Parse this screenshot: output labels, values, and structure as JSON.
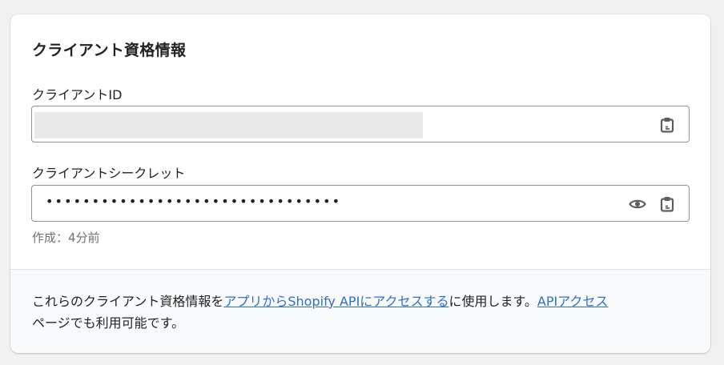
{
  "card": {
    "title": "クライアント資格情報"
  },
  "client_id": {
    "label": "クライアントID",
    "copy_icon": "clipboard-icon"
  },
  "client_secret": {
    "label": "クライアントシークレット",
    "masked_value": "••••••••••••••••••••••••••••••••",
    "reveal_icon": "eye-icon",
    "copy_icon": "clipboard-icon",
    "created": "作成：4分前"
  },
  "footer": {
    "text_1": "これらのクライアント資格情報を",
    "link_1": "アプリからShopify APIにアクセスする",
    "text_2": "に使用します。",
    "link_2": "APIアクセス",
    "text_3": "ページでも利用可能です。"
  },
  "colors": {
    "background": "#f1f1f1",
    "card": "#ffffff",
    "footer_bg": "#f9fafb",
    "link": "#2c6ecb",
    "muted_text": "#6d7175",
    "redaction": "#e9e9e9"
  }
}
